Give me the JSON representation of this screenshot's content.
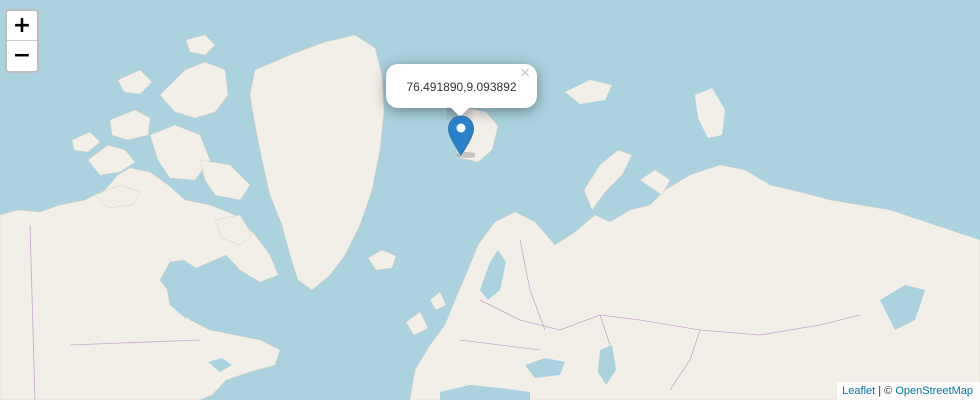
{
  "map": {
    "zoom_in_label": "+",
    "zoom_out_label": "−",
    "popup": {
      "text": "76.491890,9.093892",
      "close_label": "×"
    },
    "marker": {
      "lat": 76.49189,
      "lng": 9.093892,
      "color": "#2a81cb"
    },
    "attribution": {
      "leaflet": "Leaflet",
      "separator": " | © ",
      "osm": "OpenStreetMap"
    },
    "colors": {
      "water": "#aad3df",
      "land": "#f2efe9",
      "border": "#c6a8c6"
    }
  }
}
